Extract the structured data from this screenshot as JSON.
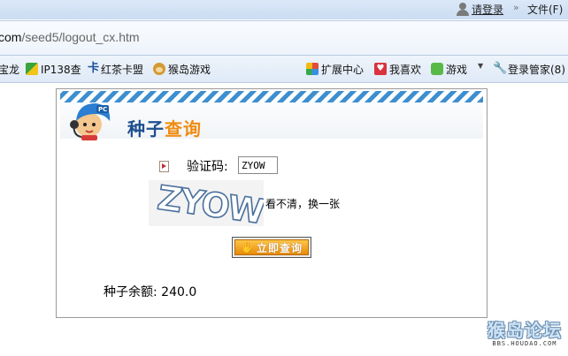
{
  "top_bar": {
    "login_label": "请登录",
    "chevron": "»",
    "file_menu": "文件(F)"
  },
  "address_bar": {
    "url_host": "com",
    "url_path": "/seed5/logout_cx.htm"
  },
  "bookmarks": [
    {
      "label": "宝龙",
      "icon": "none"
    },
    {
      "label": "IP138查",
      "icon": "ip138-icon"
    },
    {
      "label": "红茶卡盟",
      "icon": "hongcha-icon"
    },
    {
      "label": "猴岛游戏",
      "icon": "monkey-icon"
    }
  ],
  "toolbar_right": [
    {
      "label": "扩展中心",
      "icon": "extension-icon"
    },
    {
      "label": "我喜欢",
      "icon": "heart-icon"
    },
    {
      "label": "游戏",
      "icon": "game-icon"
    },
    {
      "label": "登录管家(8)",
      "icon": "wrench-icon"
    }
  ],
  "panel": {
    "title_part1": "种子",
    "title_part2": "查询",
    "captcha_label": "验证码:",
    "captcha_value": "ZYOW",
    "captcha_image_text": "ZYOW",
    "refresh_text": "看不清，换一张",
    "query_button": "立即查询",
    "balance": "种子余额: 240.0"
  },
  "watermark": {
    "main": "猴岛论坛",
    "sub": "BBS.HOUDAO.COM"
  },
  "colors": {
    "title_blue": "#1e4f8f",
    "title_orange": "#ef8c11",
    "stripe_blue": "#3d8fd0",
    "button_orange": "#f39c12"
  }
}
